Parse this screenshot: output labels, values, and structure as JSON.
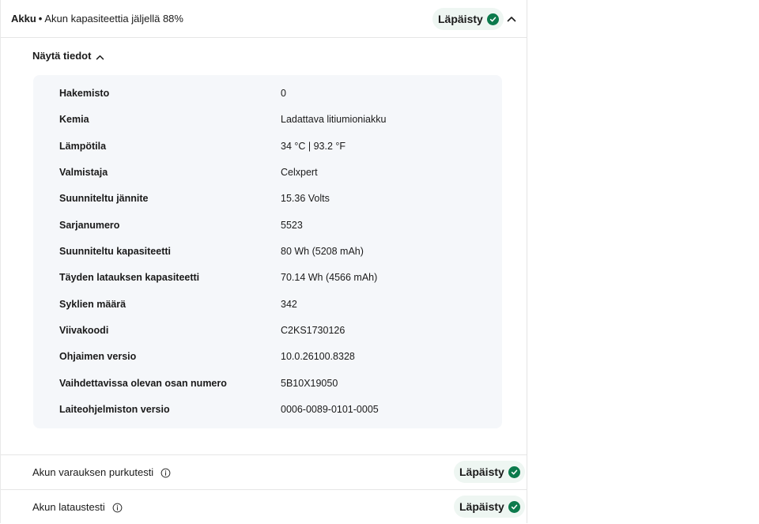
{
  "header": {
    "title": "Akku",
    "separator": "•",
    "subtitle": "Akun kapasiteettia jäljellä 88%",
    "status": "Läpäisty",
    "status_icon": "check-circle-icon",
    "collapse_icon": "chevron-up-icon"
  },
  "details": {
    "toggle_label": "Näytä tiedot",
    "toggle_icon": "chevron-up-icon",
    "rows": [
      {
        "key": "Hakemisto",
        "value": "0"
      },
      {
        "key": "Kemia",
        "value": "Ladattava litiumioniakku"
      },
      {
        "key": "Lämpötila",
        "value": "34 °C | 93.2 °F"
      },
      {
        "key": "Valmistaja",
        "value": "Celxpert"
      },
      {
        "key": "Suunniteltu jännite",
        "value": "15.36 Volts"
      },
      {
        "key": "Sarjanumero",
        "value": "5523"
      },
      {
        "key": "Suunniteltu kapasiteetti",
        "value": "80 Wh (5208 mAh)"
      },
      {
        "key": "Täyden latauksen kapasiteetti",
        "value": "70.14 Wh (4566 mAh)"
      },
      {
        "key": "Syklien määrä",
        "value": "342"
      },
      {
        "key": "Viivakoodi",
        "value": "C2KS1730126"
      },
      {
        "key": "Ohjaimen versio",
        "value": "10.0.26100.8328"
      },
      {
        "key": "Vaihdettavissa olevan osan numero",
        "value": "5B10X19050"
      },
      {
        "key": "Laiteohjelmiston versio",
        "value": "0006-0089-0101-0005"
      }
    ]
  },
  "tests": [
    {
      "label": "Akun varauksen purkutesti",
      "status": "Läpäisty",
      "info_icon": "info-icon"
    },
    {
      "label": "Akun lataustesti",
      "status": "Läpäisty",
      "info_icon": "info-icon"
    }
  ],
  "colors": {
    "pass_green": "#0c7a4c",
    "badge_bg": "#eef6f2",
    "card_bg": "#f5f7fa"
  }
}
